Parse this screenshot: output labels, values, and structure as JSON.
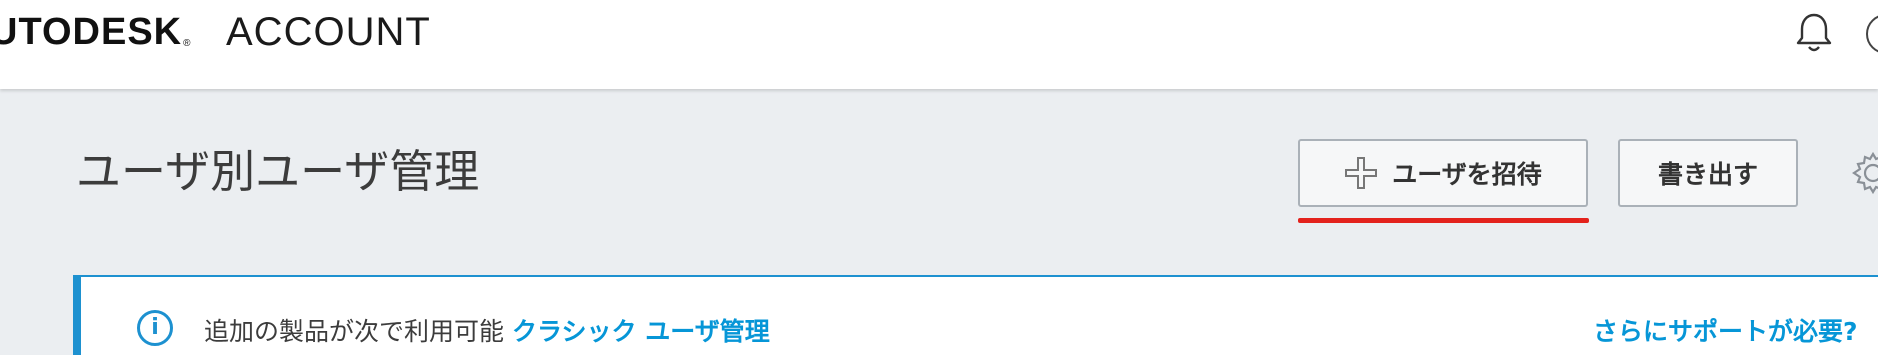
{
  "header": {
    "logo_text": "UTODESK",
    "logo_reg": "®",
    "product_name": "ACCOUNT"
  },
  "page": {
    "title": "ユーザ別ユーザ管理"
  },
  "toolbar": {
    "invite_label": "ユーザを招待",
    "export_label": "書き出す"
  },
  "banner": {
    "text": "追加の製品が次で利用可能",
    "link_text": "クラシック ユーザ管理",
    "support_text": "さらにサポートが必要?"
  },
  "icons": [
    "bell-icon",
    "avatar",
    "plus-icon",
    "gear-icon",
    "info-icon"
  ],
  "colors": {
    "accent_underline": "#e3221c",
    "link": "#0696d7",
    "banner_border": "#1d91d0"
  }
}
